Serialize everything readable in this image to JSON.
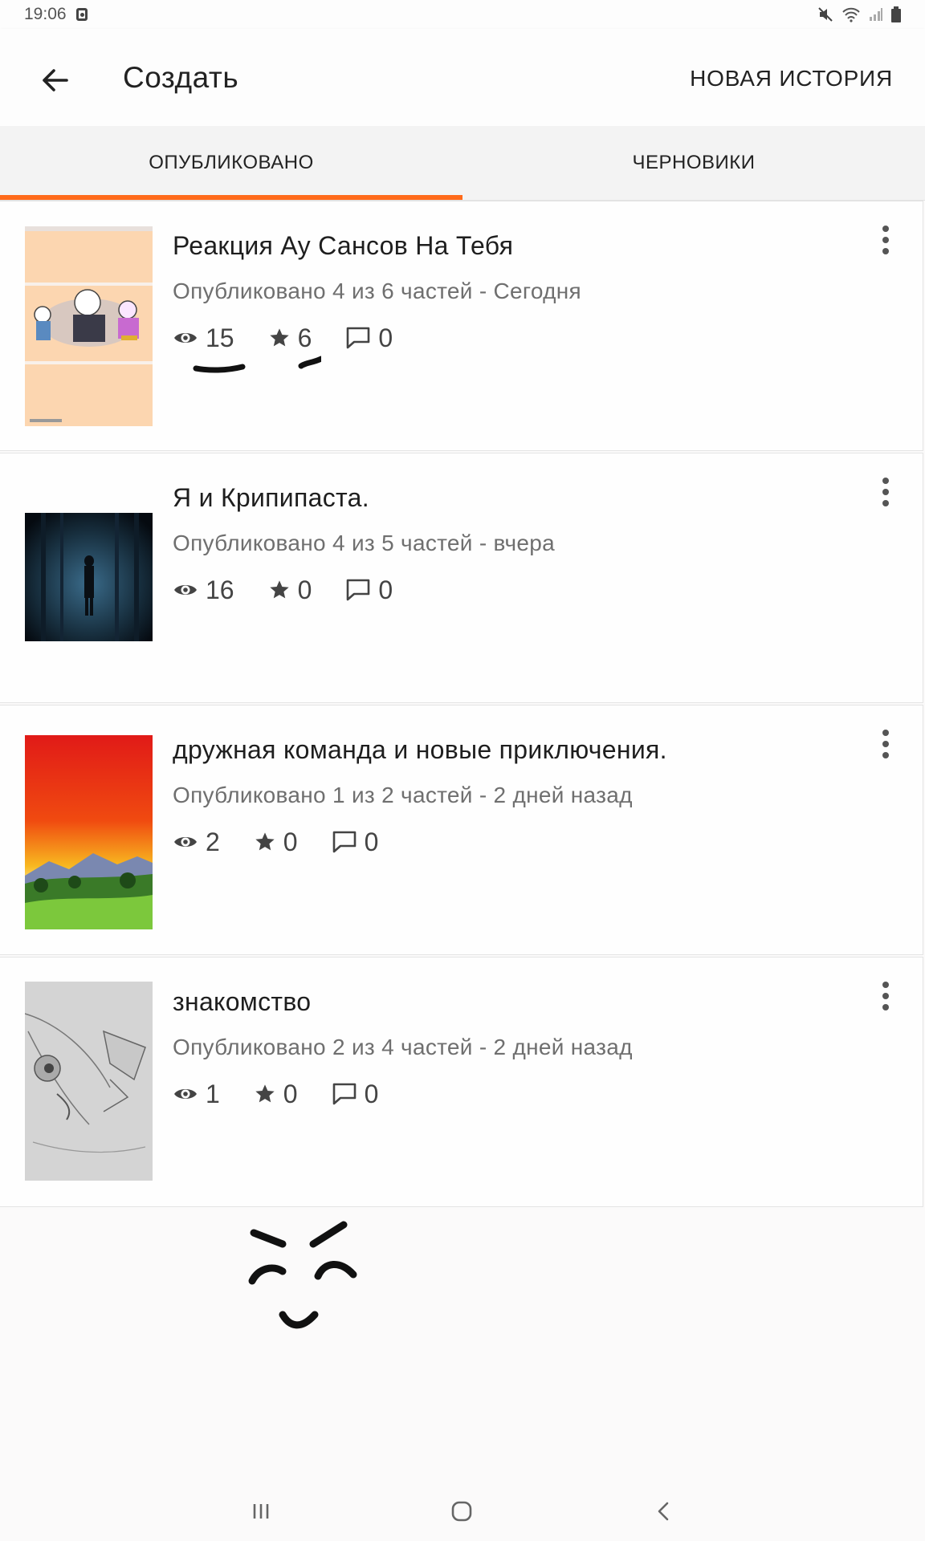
{
  "status_bar": {
    "time": "19:06",
    "icons": [
      "notification-icon",
      "mute-icon",
      "wifi-icon",
      "signal-icon",
      "battery-icon"
    ]
  },
  "app_bar": {
    "title": "Создать",
    "action_label": "НОВАЯ ИСТОРИЯ",
    "back_icon": "arrow-left-icon"
  },
  "tabs": [
    {
      "label": "ОПУБЛИКОВАНО",
      "selected": true
    },
    {
      "label": "ЧЕРНОВИКИ",
      "selected": false
    }
  ],
  "stories": [
    {
      "title": "Реакция Ау Сансов На Тебя",
      "meta": "Опубликовано 4 из 6 частей - Сегодня",
      "views": "15",
      "votes": "6",
      "comments": "0"
    },
    {
      "title": "Я и Крипипаста.",
      "meta": "Опубликовано 4 из 5 частей - вчера",
      "views": "16",
      "votes": "0",
      "comments": "0"
    },
    {
      "title": "дружная команда и новые приключения.",
      "meta": "Опубликовано 1 из 2 частей - 2 дней назад",
      "views": "2",
      "votes": "0",
      "comments": "0"
    },
    {
      "title": "знакомство",
      "meta": "Опубликовано 2 из 4 частей - 2 дней назад",
      "views": "1",
      "votes": "0",
      "comments": "0"
    }
  ],
  "nav_bar": {
    "icons": [
      "recent-apps-icon",
      "home-icon",
      "back-nav-icon"
    ]
  },
  "colors": {
    "accent": "#ff6a1a",
    "tab_background": "#f3f3f3",
    "background": "#fbfafa"
  }
}
